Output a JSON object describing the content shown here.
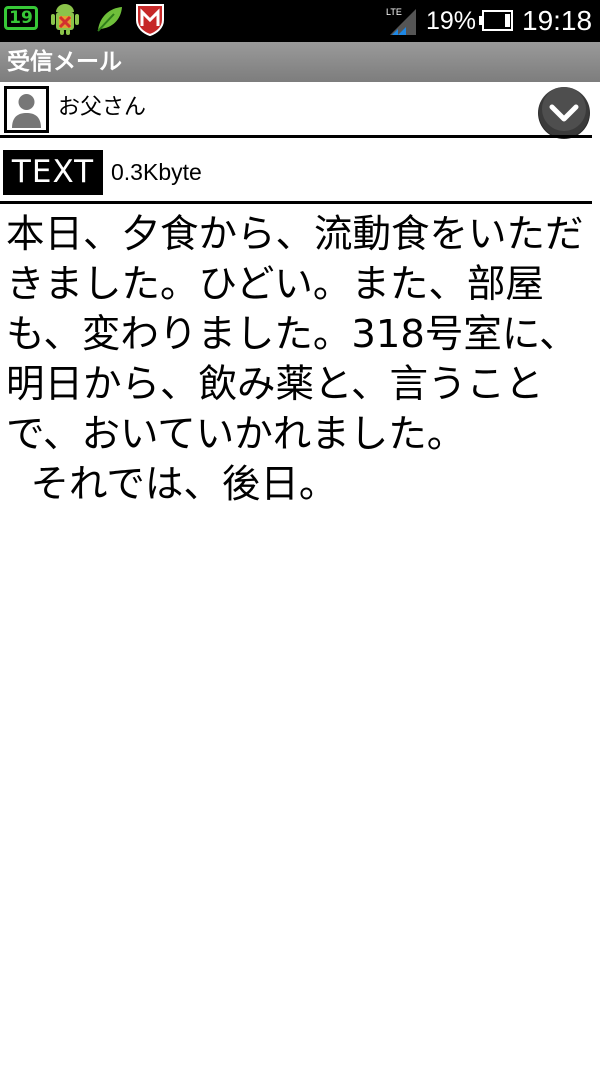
{
  "status_bar": {
    "calendar_day": "19",
    "network": "LTE",
    "battery_percent": "19%",
    "time": "19:18",
    "icons": [
      "calendar-icon",
      "android-debug-icon",
      "leaf-icon",
      "mcafee-icon",
      "lte-signal-icon",
      "battery-icon"
    ]
  },
  "header": {
    "title": "受信メール"
  },
  "sender": {
    "name": "お父さん",
    "icons": [
      "contact-avatar-icon",
      "expand-chevron-icon"
    ]
  },
  "attachment": {
    "type_label": "TEXT",
    "size": "0.3Kbyte"
  },
  "message": {
    "body": "本日、夕食から、流動食をいただきました。ひどい。また、部屋も、変わりました。318号室に、明日から、飲み薬と、言うことで、おいていかれました。\n  それでは、後日。"
  },
  "colors": {
    "status_bar_bg": "#000000",
    "title_bar_bg": "#8a8a8a",
    "calendar_green": "#37c837"
  }
}
